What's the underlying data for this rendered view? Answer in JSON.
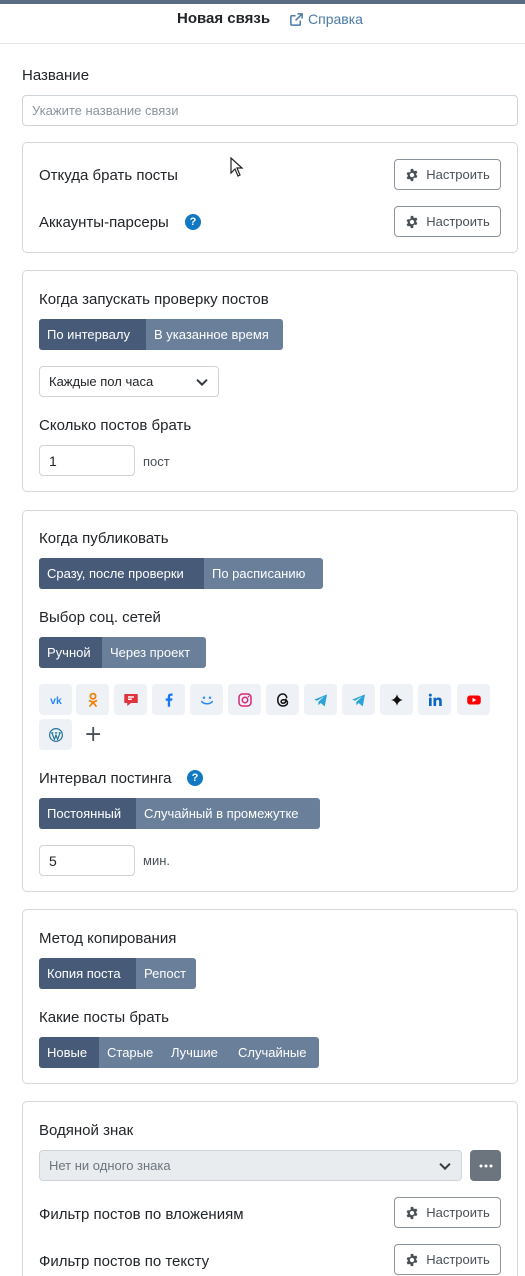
{
  "header": {
    "title": "Новая связь",
    "help_label": "Справка"
  },
  "name_section": {
    "label": "Название",
    "placeholder": "Укажите название связи"
  },
  "sources": {
    "posts_from_label": "Откуда брать посты",
    "parsers_label": "Аккаунты-парсеры",
    "help_mark": "?",
    "configure_label": "Настроить"
  },
  "check": {
    "title": "Когда запускать проверку постов",
    "modes": [
      "По интервалу",
      "В указанное время"
    ],
    "interval_value": "Каждые пол часа",
    "count_label": "Сколько постов брать",
    "count_value": "1",
    "count_unit": "пост"
  },
  "publish": {
    "title": "Когда публиковать",
    "modes": [
      "Сразу, после проверки",
      "По расписанию"
    ],
    "social_label": "Выбор соц. сетей",
    "social_modes": [
      "Ручной",
      "Через проект"
    ],
    "socials": [
      "vk-icon",
      "odnoklassniki-icon",
      "vk-message-icon",
      "facebook-icon",
      "vk-group-icon",
      "instagram-icon",
      "threads-icon",
      "telegram-icon",
      "telegram-channel-icon",
      "sparkle-icon",
      "linkedin-icon",
      "youtube-icon",
      "wordpress-icon"
    ],
    "add_symbol": "+",
    "interval_label": "Интервал постинга",
    "interval_modes": [
      "Постоянный",
      "Случайный в промежутке"
    ],
    "interval_value": "5",
    "interval_unit": "мин."
  },
  "copy": {
    "method_label": "Метод копирования",
    "method_modes": [
      "Копия поста",
      "Репост"
    ],
    "which_label": "Какие посты брать",
    "which_modes": [
      "Новые",
      "Старые",
      "Лучшие",
      "Случайные"
    ]
  },
  "extra": {
    "watermark_label": "Водяной знак",
    "watermark_value": "Нет ни одного знака",
    "attach_filter_label": "Фильтр постов по вложениям",
    "text_filter_label": "Фильтр постов по тексту"
  },
  "colors": {
    "segment_active": "#475b78",
    "segment_inactive": "#6a7f99",
    "help_blue": "#1179c4",
    "link": "#4a7aa8"
  }
}
